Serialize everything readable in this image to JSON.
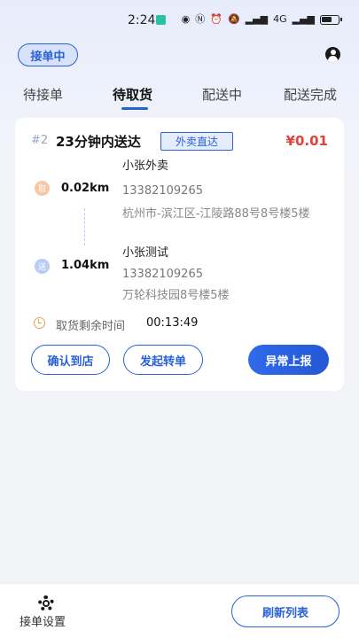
{
  "status_bar": {
    "time": "2:24",
    "icons": [
      "eye-icon",
      "nfc-icon",
      "alarm-icon",
      "mute-icon",
      "wifi-icon",
      "signal-icon",
      "battery-icon"
    ],
    "signal_label": "4G"
  },
  "header": {
    "status_pill": "接单中",
    "user_icon": "user-icon"
  },
  "tabs": [
    {
      "label": "待接单",
      "active": false
    },
    {
      "label": "待取货",
      "active": true
    },
    {
      "label": "配送中",
      "active": false
    },
    {
      "label": "配送完成",
      "active": false
    }
  ],
  "order": {
    "number": "#2",
    "title": "23分钟内送达",
    "tag": "外卖直达",
    "price": "¥0.01",
    "pickup": {
      "badge": "取",
      "distance": "0.02km",
      "name": "小张外卖",
      "phone": "13382109265",
      "address": "杭州市-滨江区-江陵路88号8号楼5楼"
    },
    "delivery": {
      "badge": "送",
      "distance": "1.04km",
      "name": "小张测试",
      "phone": "13382109265",
      "address": "万轮科技园8号楼5楼"
    },
    "timer_label": "取货剩余时间",
    "timer_value": "00:13:49",
    "buttons": {
      "arrive": "确认到店",
      "transfer": "发起转单",
      "exception": "异常上报"
    }
  },
  "bottom": {
    "settings_label": "接单设置",
    "refresh_label": "刷新列表"
  },
  "colors": {
    "accent": "#2a62d8",
    "price": "#e0413c",
    "pickup_dot": "#f7c8a6",
    "delivery_dot": "#b7cdf6"
  }
}
